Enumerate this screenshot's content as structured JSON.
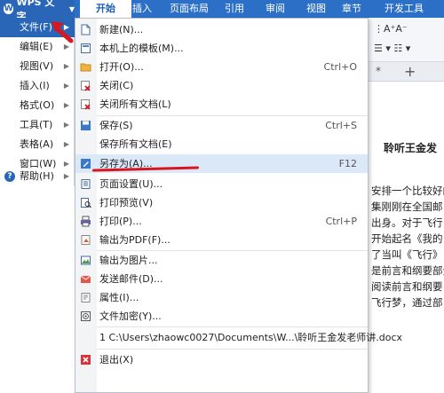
{
  "app": {
    "brand": "WPS 文字",
    "tabs": [
      "开始",
      "插入",
      "页面布局",
      "引用",
      "审阅",
      "视图",
      "章节",
      "开发工具"
    ],
    "active_tab": "开始"
  },
  "side_menu": {
    "items": [
      {
        "label": "文件(F)",
        "has_submenu": true,
        "selected": true
      },
      {
        "label": "编辑(E)",
        "has_submenu": true
      },
      {
        "label": "视图(V)",
        "has_submenu": true
      },
      {
        "label": "插入(I)",
        "has_submenu": true
      },
      {
        "label": "格式(O)",
        "has_submenu": true
      },
      {
        "label": "工具(T)",
        "has_submenu": true
      },
      {
        "label": "表格(A)",
        "has_submenu": true
      },
      {
        "label": "窗口(W)",
        "has_submenu": true
      },
      {
        "label": "帮助(H)",
        "has_submenu": true,
        "icon": "help-icon"
      }
    ]
  },
  "file_menu": {
    "items": [
      {
        "label": "新建(N)...",
        "icon": "new-document-icon"
      },
      {
        "label": "本机上的模板(M)...",
        "icon": "template-icon"
      },
      {
        "label": "打开(O)...",
        "shortcut": "Ctrl+O",
        "icon": "open-folder-icon"
      },
      {
        "label": "关闭(C)",
        "icon": "close-document-icon"
      },
      {
        "label": "关闭所有文档(L)",
        "icon": "close-all-icon"
      },
      {
        "label": "保存(S)",
        "shortcut": "Ctrl+S",
        "icon": "save-icon"
      },
      {
        "label": "保存所有文档(E)"
      },
      {
        "label": "另存为(A)...",
        "shortcut": "F12",
        "icon": "save-as-icon",
        "highlighted": true
      },
      {
        "label": "页面设置(U)...",
        "icon": "page-setup-icon"
      },
      {
        "label": "打印预览(V)",
        "icon": "print-preview-icon"
      },
      {
        "label": "打印(P)...",
        "shortcut": "Ctrl+P",
        "icon": "printer-icon"
      },
      {
        "label": "输出为PDF(F)...",
        "icon": "export-pdf-icon"
      },
      {
        "label": "输出为图片...",
        "icon": "export-image-icon"
      },
      {
        "label": "发送邮件(D)...",
        "icon": "email-icon"
      },
      {
        "label": "属性(I)...",
        "icon": "properties-icon"
      },
      {
        "label": "文件加密(Y)...",
        "icon": "encrypt-icon"
      },
      {
        "label": "1 C:\\Users\\zhaowc0027\\Documents\\W...\\聆听王金发老师讲.docx"
      },
      {
        "label": "退出(X)",
        "icon": "exit-icon"
      }
    ]
  },
  "document": {
    "tab_marker": "*",
    "new_tab": "+",
    "title": "聆听王金发",
    "lines": [
      "安排一个比较好的",
      "集刚刚在全国邮",
      "出身。对于飞行",
      "开始起名《我的",
      "了当叫《飞行》",
      "是前言和纲要部分",
      "阅读前言和纲要",
      "飞行梦，通过部"
    ]
  },
  "colors": {
    "ribbon_blue": "#2c6fc6",
    "selected_blue": "#2a66b8",
    "hover_bg": "#dbe8f8",
    "annotation_red": "#d8161d"
  }
}
